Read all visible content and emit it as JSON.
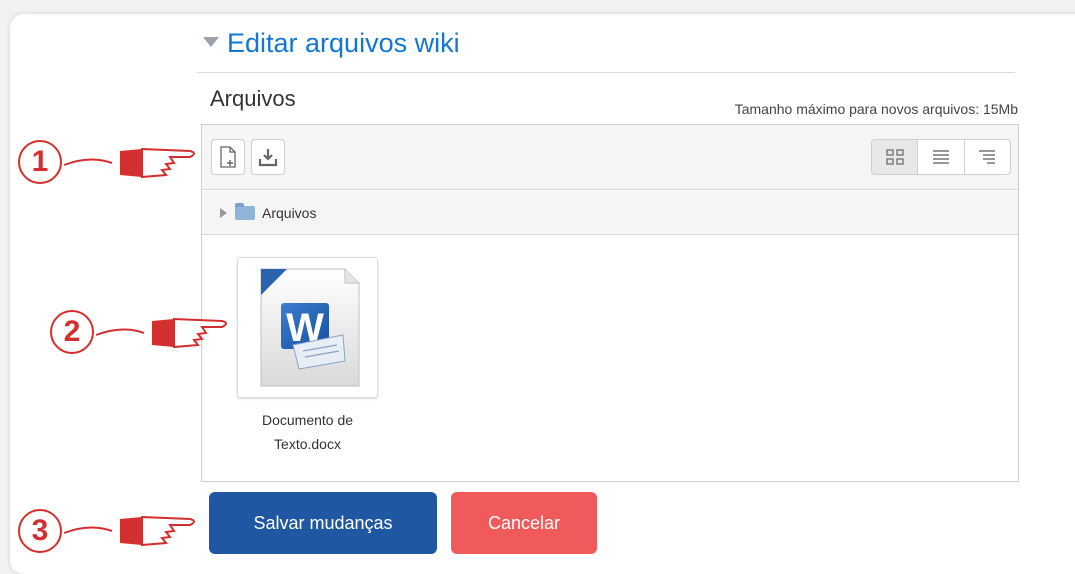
{
  "header": {
    "title": "Editar arquivos wiki"
  },
  "files": {
    "label": "Arquivos",
    "max_size": "Tamanho máximo para novos arquivos: 15Mb",
    "path_folder": "Arquivos",
    "items": [
      {
        "name_line1": "Documento de",
        "name_line2": "Texto.docx",
        "icon": "word-doc-icon"
      }
    ]
  },
  "toolbar": {
    "add_icon": "add-file-icon",
    "download_icon": "download-icon",
    "views": [
      "grid-view-icon",
      "list-view-icon",
      "tree-view-icon"
    ]
  },
  "actions": {
    "save_label": "Salvar mudanças",
    "cancel_label": "Cancelar"
  },
  "callouts": [
    "1",
    "2",
    "3"
  ],
  "colors": {
    "title": "#1177d1",
    "save": "#1f57a3",
    "cancel": "#f05a5a",
    "callout": "#d32f2f"
  }
}
